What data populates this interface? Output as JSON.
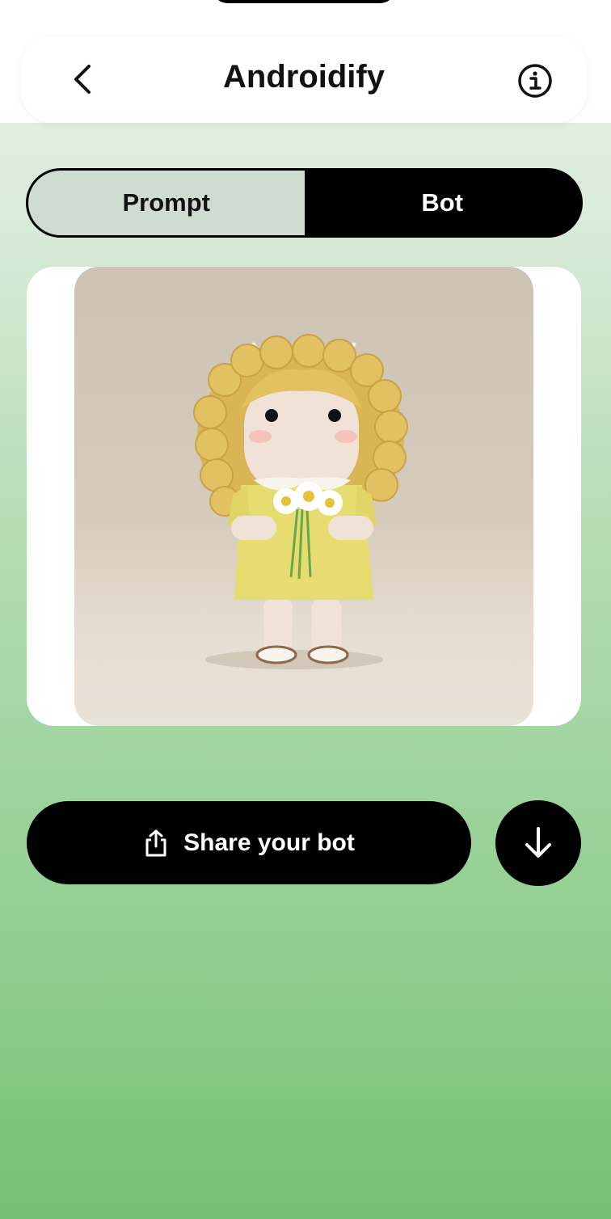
{
  "header": {
    "title": "Androidify",
    "back_icon": "chevron-left-icon",
    "info_icon": "info-icon"
  },
  "tabs": [
    {
      "label": "Prompt",
      "selected": false
    },
    {
      "label": "Bot",
      "selected": true
    }
  ],
  "image": {
    "description_icon": "generated-bot-image"
  },
  "actions": {
    "share_label": "Share your bot",
    "share_icon": "share-icon",
    "download_icon": "download-arrow-icon"
  },
  "colors": {
    "accent_black": "#000000",
    "tab_unselected_bg": "#cfdcd0",
    "gradient_top": "#e8f1e8",
    "gradient_bottom": "#74c072"
  }
}
